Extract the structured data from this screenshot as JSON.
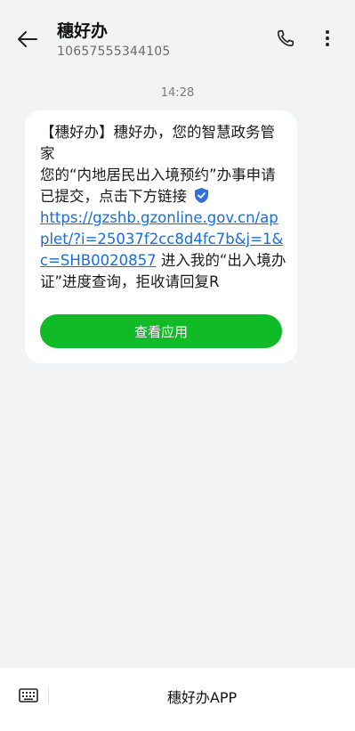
{
  "header": {
    "title": "穗好办",
    "sender_number": "10657555344105",
    "back_icon": "back-arrow-icon",
    "call_icon": "phone-icon",
    "more_icon": "more-vertical-icon"
  },
  "conversation": {
    "timestamp": "14:28",
    "message": {
      "text_before_link": "【穗好办】穗好办，您的智慧政务管家\n您的“内地居民出入境预约”办事申请已提交，点击下方链接",
      "verified_icon": "verified-shield-icon",
      "link": "https://gzshb.gzonline.gov.cn/applet/?i=25037f2cc8d4fc7b&j=1&c=SHB0020857",
      "text_after_link": " 进入我的“出入境办证”进度查询，拒收请回复R",
      "action_label": "查看应用"
    }
  },
  "bottom_bar": {
    "keyboard_icon": "keyboard-icon",
    "label": "穗好办APP"
  },
  "colors": {
    "background": "#f2f3f5",
    "bubble": "#ffffff",
    "link": "#1a6dd6",
    "action_button": "#11bb27",
    "verified_badge": "#2f6fe0"
  }
}
